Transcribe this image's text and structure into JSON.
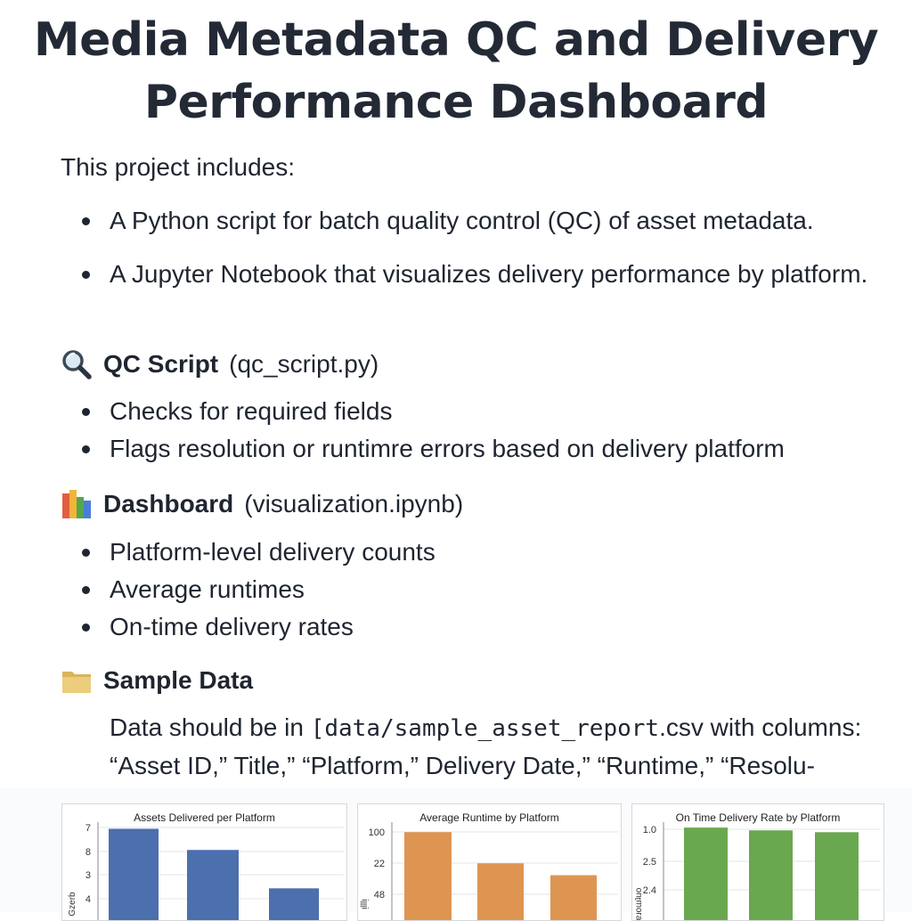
{
  "title": "Media Metadata QC and Delivery Performance Dashboard",
  "intro": "This project includes:",
  "overview_items": [
    "A Python script for batch quality control (QC) of asset metadata.",
    "A Jupyter Notebook that visualizes delivery performance by platform."
  ],
  "qc_section": {
    "icon": "magnifying-glass-icon",
    "title": "QC Script",
    "file": "(qc_script.py)",
    "items": [
      "Checks for required fields",
      "Flags resolution or runtimre errors based on delivery platform"
    ]
  },
  "dashboard_section": {
    "icon": "bar-chart-icon",
    "title": "Dashboard",
    "file": "(visualization.ipynb)",
    "items": [
      "Platform-level delivery counts",
      "Average runtimes",
      "On-time delivery rates"
    ]
  },
  "sample_section": {
    "icon": "folder-icon",
    "title": "Sample Data",
    "text_before": "Data should be in ",
    "path": "[data/sample_asset_report",
    "text_after": ".csv with columns: “Asset ID,” Title,” “Platform,” Delivery Date,” “Runtime,” “Resolu-"
  },
  "chart_data": [
    {
      "type": "bar",
      "title": "Assets Delivered per Platform",
      "ylabel": "Gzerb",
      "yticks": [
        "7",
        "8",
        "3",
        "4"
      ],
      "values": [
        6.9,
        5.3,
        2.4
      ],
      "ylim": [
        0,
        7.2
      ],
      "color": "#4c6fad"
    },
    {
      "type": "bar",
      "title": "Average Runtime by Platform",
      "ylabel": "ᴉlllᴉ",
      "yticks": [
        "100",
        "22",
        "48"
      ],
      "values": [
        96,
        62,
        49
      ],
      "ylim": [
        0,
        104
      ],
      "color": "#de9552"
    },
    {
      "type": "bar",
      "title": "On Time Delivery Rate by Platform",
      "ylabel": "ɐɹoɯʇuo",
      "yticks": [
        "1.0",
        "2.5",
        "2.4"
      ],
      "values": [
        1.0,
        0.97,
        0.95
      ],
      "ylim": [
        0,
        1.03
      ],
      "color": "#6aa84f"
    }
  ]
}
